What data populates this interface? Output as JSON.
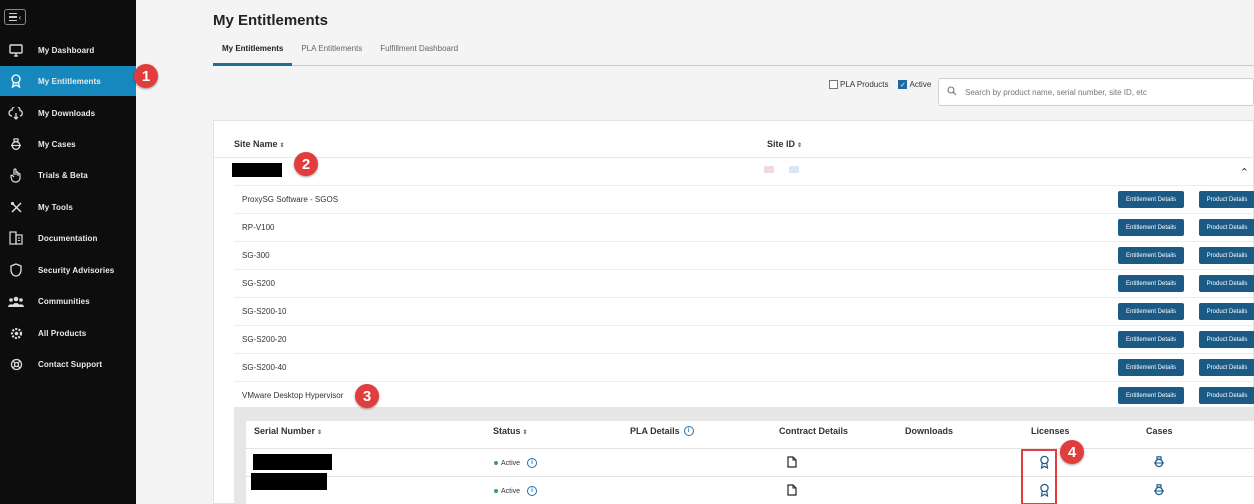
{
  "sidebar": {
    "items": [
      {
        "label": "My Dashboard",
        "icon": "monitor-icon"
      },
      {
        "label": "My Entitlements",
        "icon": "ribbon-icon",
        "active": true
      },
      {
        "label": "My Downloads",
        "icon": "cloud-download-icon"
      },
      {
        "label": "My Cases",
        "icon": "case-icon"
      },
      {
        "label": "Trials & Beta",
        "icon": "hand-icon"
      },
      {
        "label": "My Tools",
        "icon": "tools-icon"
      },
      {
        "label": "Documentation",
        "icon": "documentation-icon"
      },
      {
        "label": "Security Advisories",
        "icon": "shield-icon"
      },
      {
        "label": "Communities",
        "icon": "people-icon"
      },
      {
        "label": "All Products",
        "icon": "gear-icon"
      },
      {
        "label": "Contact Support",
        "icon": "support-icon"
      }
    ]
  },
  "callouts": [
    "1",
    "2",
    "3",
    "4"
  ],
  "page": {
    "title": "My Entitlements"
  },
  "tabs": [
    {
      "label": "My Entitlements",
      "active": true
    },
    {
      "label": "PLA Entitlements"
    },
    {
      "label": "Fulfillment Dashboard"
    }
  ],
  "filters": {
    "pla_products": {
      "label": "PLA Products",
      "checked": false
    },
    "active": {
      "label": "Active",
      "checked": true
    }
  },
  "search": {
    "placeholder": "Search by product name, serial number, site ID, etc"
  },
  "table": {
    "headers": {
      "site_name": "Site Name",
      "site_id": "Site ID"
    },
    "products": [
      "ProxySG Software - SGOS",
      "RP-V100",
      "SG-300",
      "SG-S200",
      "SG-S200-10",
      "SG-S200-20",
      "SG-S200-40",
      "VMware Desktop Hypervisor"
    ],
    "buttons": {
      "entitlement": "Entitlement Details",
      "product": "Product Details"
    }
  },
  "subtable": {
    "headers": {
      "serial": "Serial Number",
      "status": "Status",
      "pla": "PLA Details",
      "contract": "Contract Details",
      "downloads": "Downloads",
      "licenses": "Licenses",
      "cases": "Cases"
    },
    "rows": [
      {
        "status": "Active"
      },
      {
        "status": "Active"
      }
    ]
  },
  "colors": {
    "accent": "#1788bd",
    "button": "#1c5a86",
    "callout": "#e23d3d",
    "active_dot": "#3fa34d"
  }
}
